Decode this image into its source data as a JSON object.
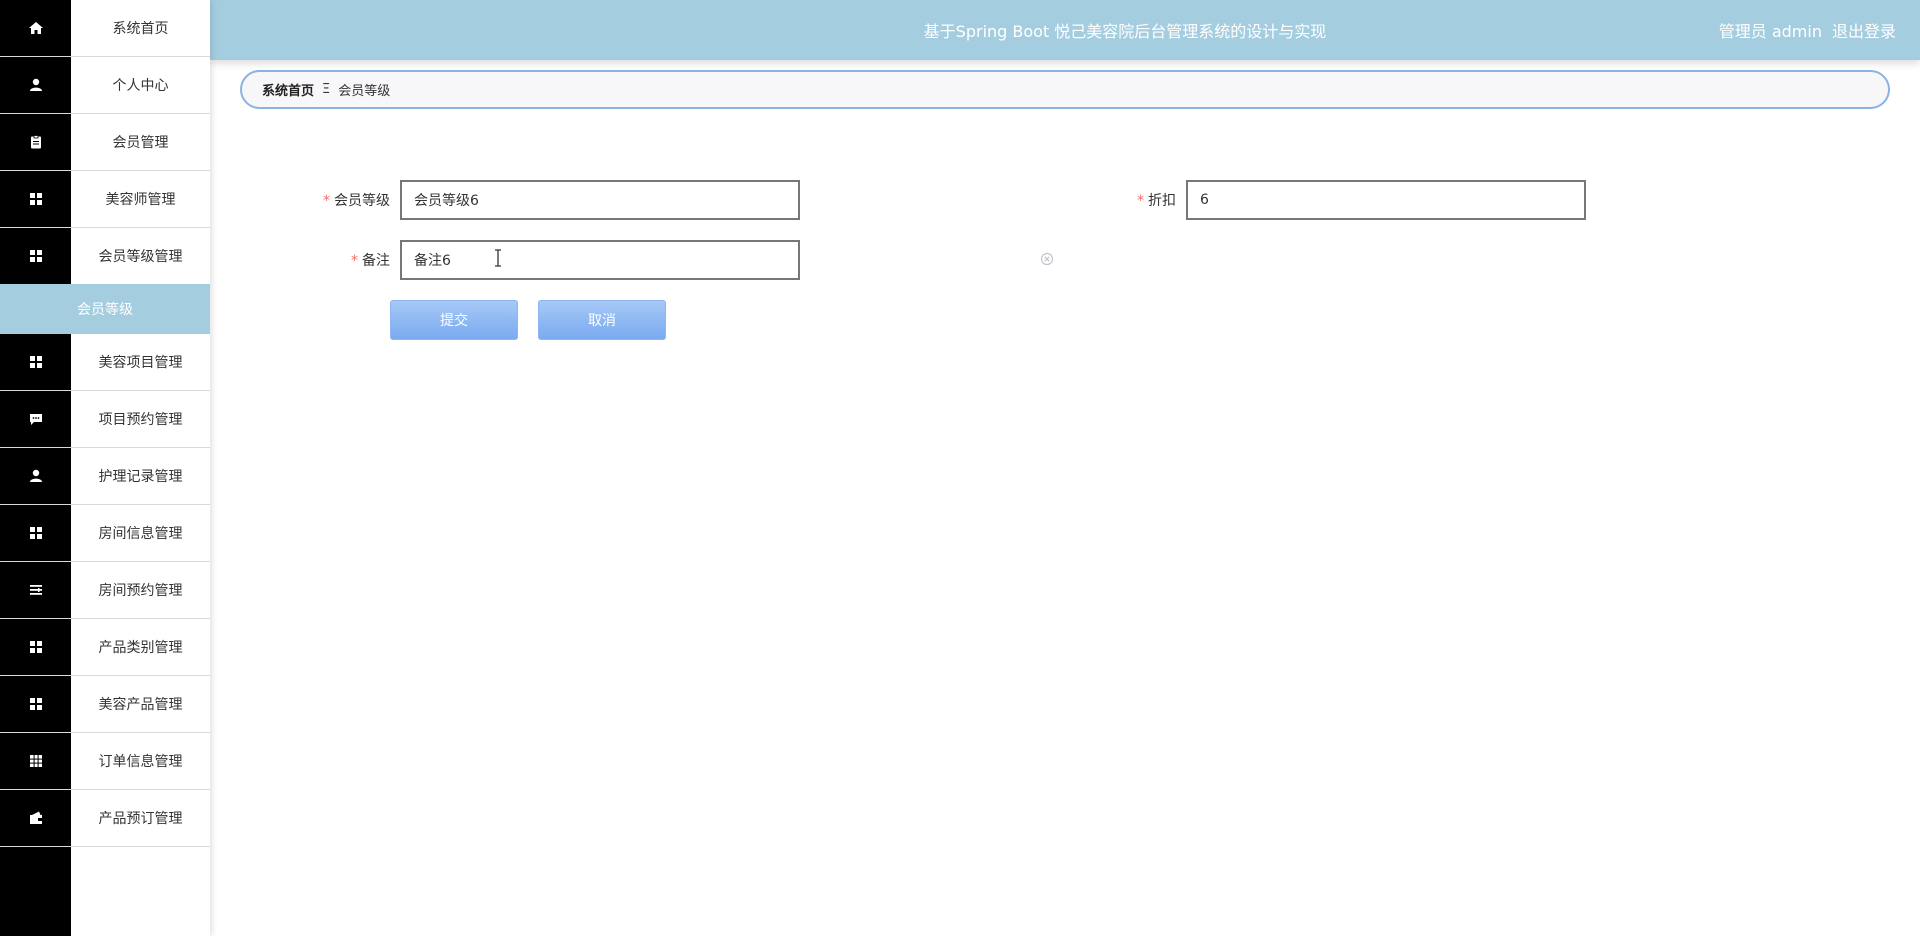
{
  "header": {
    "title": "基于Spring Boot 悦己美容院后台管理系统的设计与实现",
    "user_label": "管理员 admin",
    "logout_label": "退出登录"
  },
  "sidebar": {
    "items": [
      {
        "label": "系统首页",
        "icon": "home-icon"
      },
      {
        "label": "个人中心",
        "icon": "user-icon"
      },
      {
        "label": "会员管理",
        "icon": "clipboard-icon"
      },
      {
        "label": "美容师管理",
        "icon": "grid-icon"
      },
      {
        "label": "会员等级管理",
        "icon": "grid-icon"
      },
      {
        "label": "美容项目管理",
        "icon": "grid-icon"
      },
      {
        "label": "项目预约管理",
        "icon": "chat-icon"
      },
      {
        "label": "护理记录管理",
        "icon": "user-icon"
      },
      {
        "label": "房间信息管理",
        "icon": "grid-icon"
      },
      {
        "label": "房间预约管理",
        "icon": "list-icon"
      },
      {
        "label": "产品类别管理",
        "icon": "grid-icon"
      },
      {
        "label": "美容产品管理",
        "icon": "grid-icon"
      },
      {
        "label": "订单信息管理",
        "icon": "table-icon"
      },
      {
        "label": "产品预订管理",
        "icon": "wallet-icon"
      }
    ],
    "submenu_active": "会员等级"
  },
  "breadcrumb": {
    "home": "系统首页",
    "separator": "Ξ",
    "current": "会员等级"
  },
  "form": {
    "level_label": "会员等级",
    "level_value": "会员等级6",
    "discount_label": "折扣",
    "discount_value": "6",
    "remark_label": "备注",
    "remark_value": "备注6",
    "required_mark": "*",
    "submit_label": "提交",
    "cancel_label": "取消"
  },
  "colors": {
    "header_bg": "#a5cde0",
    "sidebar_icon_bg": "#000000",
    "active_submenu_bg": "#a5cde0",
    "button_bg": "#8fb5ee",
    "required": "#f56c6c"
  }
}
